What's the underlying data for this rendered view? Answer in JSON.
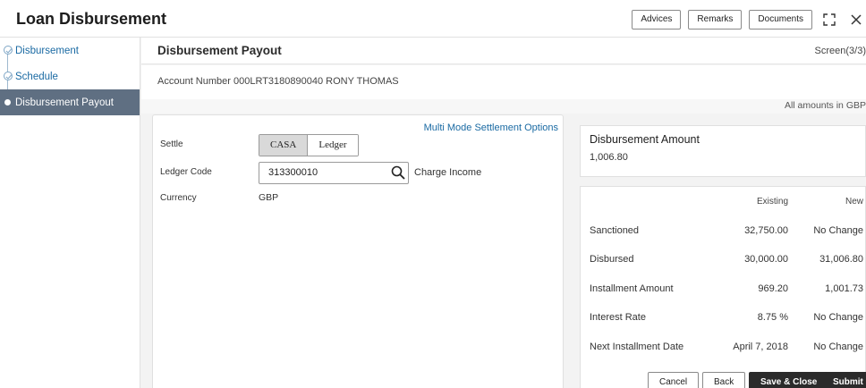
{
  "header": {
    "title": "Loan Disbursement",
    "actions": [
      "Advices",
      "Remarks",
      "Documents"
    ],
    "icons": [
      "expand-icon",
      "close-icon"
    ]
  },
  "sidebar": {
    "items": [
      {
        "label": "Disbursement",
        "state": "completed"
      },
      {
        "label": "Schedule",
        "state": "completed"
      },
      {
        "label": "Disbursement Payout",
        "state": "active"
      }
    ]
  },
  "section": {
    "title": "Disbursement Payout",
    "screen": "Screen(3/3)",
    "account_line": "Account Number  000LRT3180890040  RONY THOMAS",
    "amounts_note": "All amounts in GBP"
  },
  "form": {
    "settlement_link": "Multi Mode Settlement Options",
    "settle_label": "Settle",
    "settle_options": [
      "CASA",
      "Ledger"
    ],
    "settle_selected": "CASA",
    "ledger_code_label": "Ledger Code",
    "ledger_code_value": "313300010",
    "ledger_code_desc": "Charge Income",
    "currency_label": "Currency",
    "currency_value": "GBP"
  },
  "disbursement_amount": {
    "title": "Disbursement Amount",
    "value": "1,006.80"
  },
  "summary": {
    "headers": [
      "",
      "Existing",
      "New"
    ],
    "rows": [
      [
        "Sanctioned",
        "32,750.00",
        "No Change"
      ],
      [
        "Disbursed",
        "30,000.00",
        "31,006.80"
      ],
      [
        "Installment Amount",
        "969.20",
        "1,001.73"
      ],
      [
        "Interest Rate",
        "8.75 %",
        "No Change"
      ],
      [
        "Next Installment Date",
        "April 7, 2018",
        "No Change"
      ]
    ]
  },
  "footer": {
    "buttons": [
      "Cancel",
      "Back",
      "Save & Close",
      "Submit"
    ]
  },
  "colors": {
    "accent_link": "#1a6aa3",
    "sidebar_active": "#5f6f82",
    "primary_button": "#2b2b2b"
  }
}
